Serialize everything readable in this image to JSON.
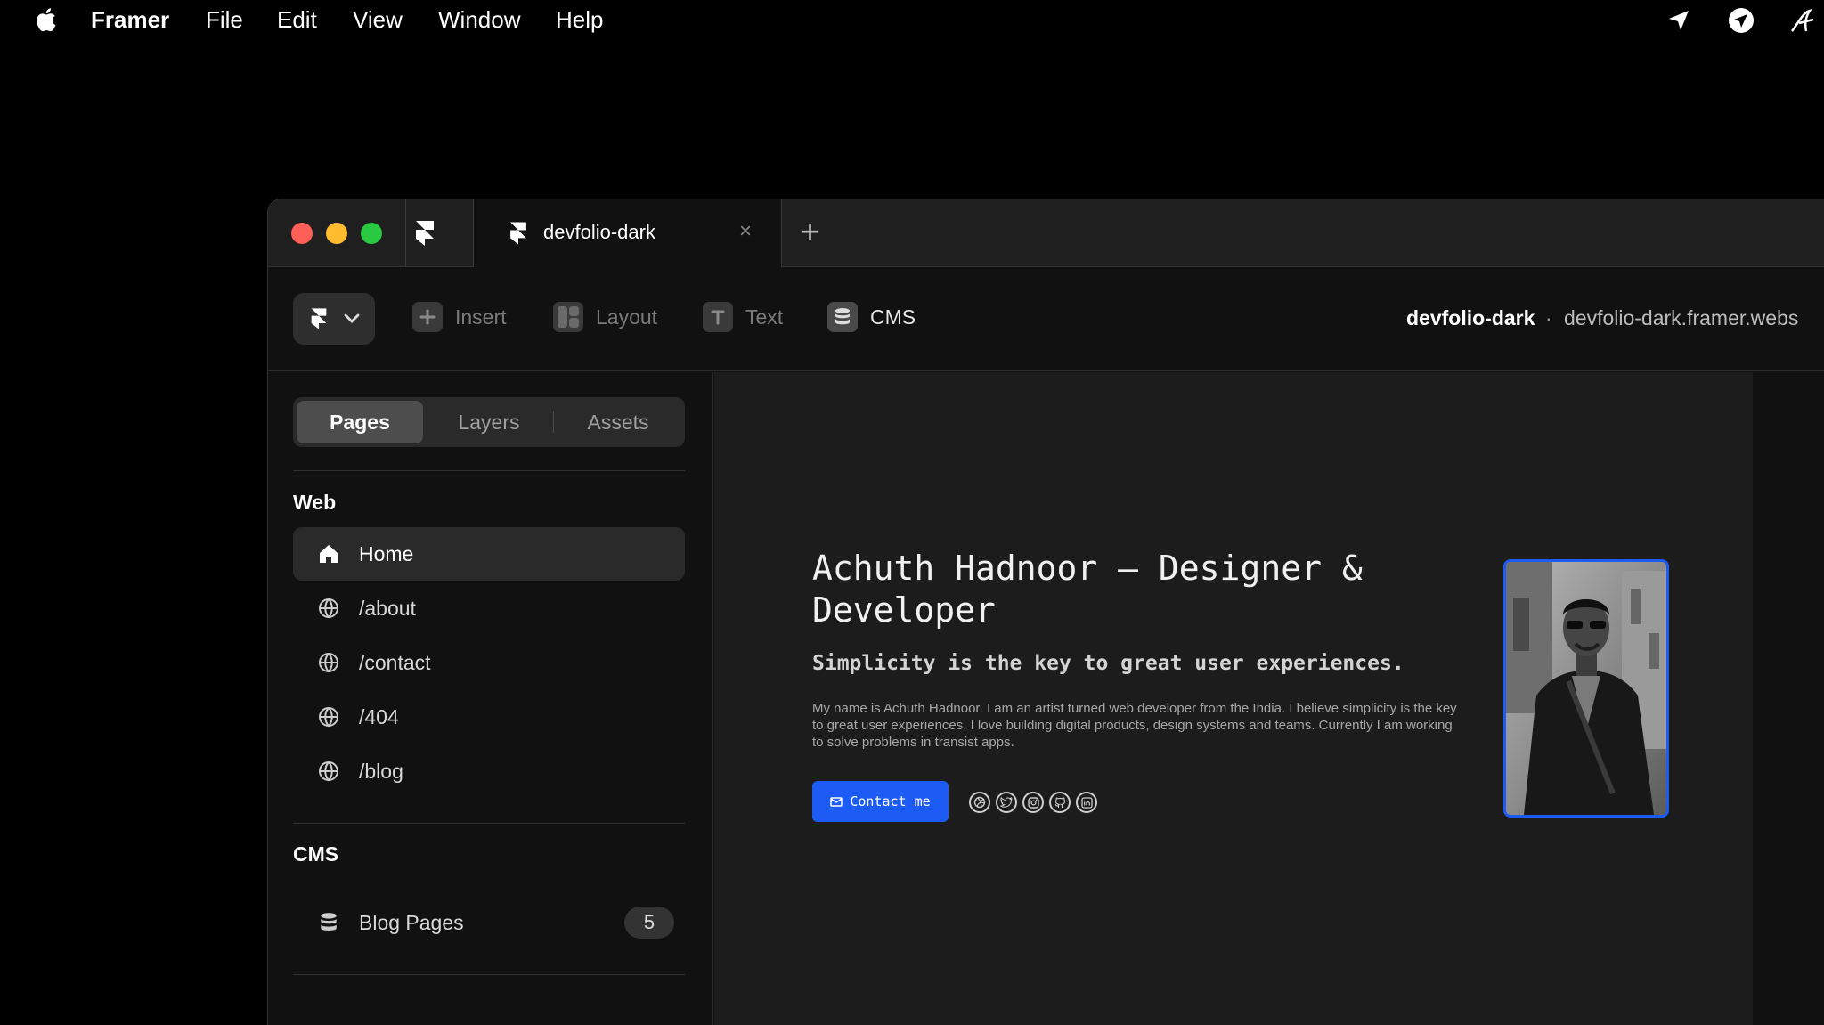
{
  "menubar": {
    "app": "Framer",
    "items": [
      "File",
      "Edit",
      "View",
      "Window",
      "Help"
    ]
  },
  "window": {
    "tab": {
      "label": "devfolio-dark",
      "close": "×"
    },
    "add_tab": "+"
  },
  "toolbar": {
    "insert": "Insert",
    "layout": "Layout",
    "text": "Text",
    "cms": "CMS",
    "project_name": "devfolio-dark",
    "separator": "·",
    "project_url": "devfolio-dark.framer.webs"
  },
  "sidebar": {
    "tabs": [
      "Pages",
      "Layers",
      "Assets"
    ],
    "web_title": "Web",
    "pages": [
      "Home",
      "/about",
      "/contact",
      "/404",
      "/blog"
    ],
    "cms_title": "CMS",
    "cms_items": [
      {
        "label": "Blog Pages",
        "count": "5"
      }
    ]
  },
  "hero": {
    "title": "Achuth Hadnoor — Designer & Developer",
    "subtitle": "Simplicity is the key to great user experiences.",
    "body": "My name is Achuth Hadnoor. I am an artist turned web developer from the India. I believe simplicity is the key to great user experiences. I love building digital products, design systems and teams. Currently I am working to solve problems in transist apps.",
    "contact_label": "Contact me",
    "socials": [
      "dribbble-icon",
      "twitter-icon",
      "instagram-icon",
      "github-icon",
      "linkedin-icon"
    ]
  },
  "colors": {
    "accent": "#1d5bf5",
    "close": "#ff5f57",
    "minimize": "#febc2e",
    "zoom": "#28c840"
  }
}
